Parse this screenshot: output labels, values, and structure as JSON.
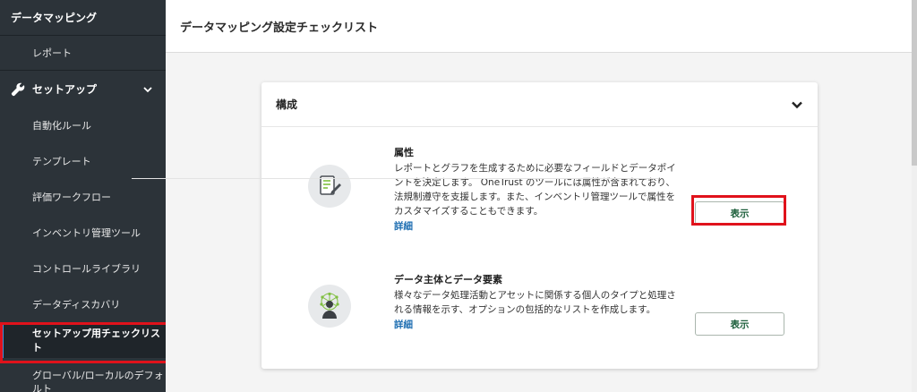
{
  "sidebar": {
    "header": "データマッピング",
    "report": "レポート",
    "section": "セットアップ",
    "items": [
      {
        "label": "自動化ルール"
      },
      {
        "label": "テンプレート"
      },
      {
        "label": "評価ワークフロー"
      },
      {
        "label": "インベントリ管理ツール"
      },
      {
        "label": "コントロールライブラリ"
      },
      {
        "label": "データディスカバリ"
      },
      {
        "label": "セットアップ用チェックリスト",
        "active": true
      },
      {
        "label": "グローバル/ローカルのデフォルト"
      }
    ]
  },
  "topbar": {
    "title": "データマッピング設定チェックリスト"
  },
  "card": {
    "title": "構成",
    "rows": [
      {
        "heading": "属性",
        "description": "レポートとグラフを生成するために必要なフィールドとデータポイントを決定します。 OneTrust のツールには属性が含まれており、法規制遵守を支援します。また、インベントリ管理ツールで属性をカスタマイズすることもできます。",
        "more": "詳細",
        "button": "表示",
        "icon": "document-edit-icon"
      },
      {
        "heading": "データ主体とデータ要素",
        "description": "様々なデータ処理活動とアセットに関係する個人のタイプと処理される情報を示す、オプションの包括的なリストを作成します。",
        "more": "詳細",
        "button": "表示",
        "icon": "person-network-icon"
      }
    ]
  },
  "colors": {
    "sidebar_bg": "#2c3339",
    "highlight": "#e0121b",
    "link": "#1f6fb2",
    "button_text": "#1b5e3a"
  }
}
